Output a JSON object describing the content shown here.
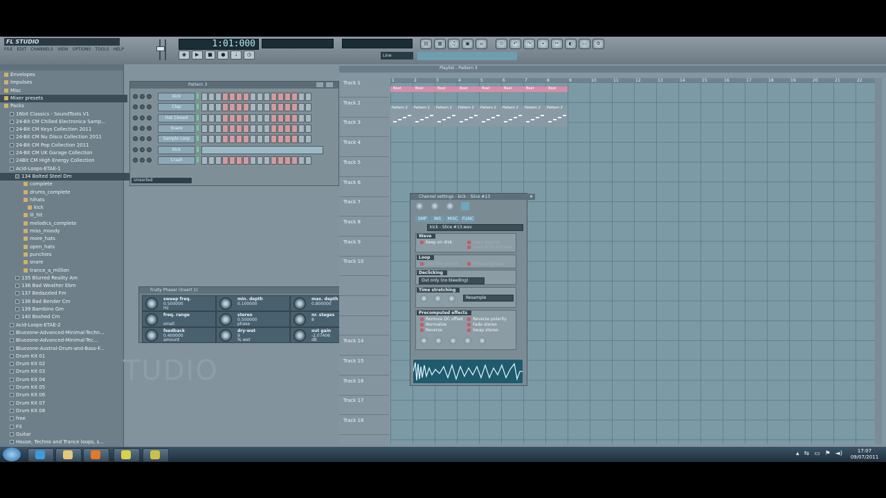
{
  "app": {
    "menu": "FL STUDIO",
    "menu_items": [
      "FILE",
      "EDIT",
      "CHANNELS",
      "VIEW",
      "OPTIONS",
      "TOOLS",
      "HELP"
    ]
  },
  "transport": {
    "time": "1:01:000",
    "line_mode": "Line",
    "hint": ""
  },
  "toolbar_icons": [
    "playlist-icon",
    "stepseq-icon",
    "pianoroll-icon",
    "browser-icon",
    "mixer-icon",
    "plugin-icon",
    "undo-icon",
    "redo-icon",
    "snap-icon",
    "cut-icon",
    "render-icon",
    "save-icon",
    "settings-icon"
  ],
  "browser": {
    "items": [
      {
        "label": "Envelopes",
        "type": "folder",
        "indent": 1
      },
      {
        "label": "Impulses",
        "type": "folder",
        "indent": 1
      },
      {
        "label": "Misc",
        "type": "folder",
        "indent": 1
      },
      {
        "label": "Mixer presets",
        "type": "folder",
        "indent": 1,
        "selected": true
      },
      {
        "label": "Packs",
        "type": "folder",
        "indent": 1
      },
      {
        "label": "16bit Classics - SoundTools V1",
        "type": "pack",
        "indent": 2
      },
      {
        "label": "24-Bit CM Chilled Electronica Samp...",
        "type": "pack",
        "indent": 2
      },
      {
        "label": "24-Bit CM Keys Collection 2011",
        "type": "pack",
        "indent": 2
      },
      {
        "label": "24-Bit CM Nu Disco Collection 2011",
        "type": "pack",
        "indent": 2
      },
      {
        "label": "24-Bit CM Pop Collection 2011",
        "type": "pack",
        "indent": 2
      },
      {
        "label": "24-Bit CM UK Garage Collection",
        "type": "pack",
        "indent": 2
      },
      {
        "label": "24Bit CM High Energy Collection",
        "type": "pack",
        "indent": 2
      },
      {
        "label": "Acid-Loops-ETAE-1",
        "type": "pack",
        "indent": 2
      },
      {
        "label": "134 Bolted Steel Dm",
        "type": "pack",
        "indent": 3,
        "selected": true
      },
      {
        "label": "complete",
        "type": "folder",
        "indent": 4
      },
      {
        "label": "drums_complete",
        "type": "folder",
        "indent": 4
      },
      {
        "label": "hihats",
        "type": "folder",
        "indent": 4
      },
      {
        "label": "kick",
        "type": "folder",
        "indent": 5
      },
      {
        "label": "lil_hit",
        "type": "folder",
        "indent": 4
      },
      {
        "label": "melodics_complete",
        "type": "folder",
        "indent": 4
      },
      {
        "label": "miss_moody",
        "type": "folder",
        "indent": 4
      },
      {
        "label": "more_hats",
        "type": "folder",
        "indent": 4
      },
      {
        "label": "open_hats",
        "type": "folder",
        "indent": 4
      },
      {
        "label": "punchies",
        "type": "folder",
        "indent": 4
      },
      {
        "label": "snare",
        "type": "folder",
        "indent": 4
      },
      {
        "label": "trance_a_million",
        "type": "folder",
        "indent": 4
      },
      {
        "label": "135 Blurred Reality Am",
        "type": "pack",
        "indent": 3
      },
      {
        "label": "136 Bad Weather Ebm",
        "type": "pack",
        "indent": 3
      },
      {
        "label": "137 Bedazzled Fm",
        "type": "pack",
        "indent": 3
      },
      {
        "label": "138 Bad Bender Cm",
        "type": "pack",
        "indent": 3
      },
      {
        "label": "139 Bambino Gm",
        "type": "pack",
        "indent": 3
      },
      {
        "label": "140 Boshed Cm",
        "type": "pack",
        "indent": 3
      },
      {
        "label": "Acid-Loops-ETAE-2",
        "type": "pack",
        "indent": 2
      },
      {
        "label": "Bluezone-Advanced-Minimal-Techn...",
        "type": "pack",
        "indent": 2
      },
      {
        "label": "Bluezone-Advanced-Minimal-Tec...",
        "type": "pack",
        "indent": 2
      },
      {
        "label": "Bluezone-Austral-Drum-and-Bass-F...",
        "type": "pack",
        "indent": 2
      },
      {
        "label": "Drum Kit 01",
        "type": "pack",
        "indent": 2
      },
      {
        "label": "Drum Kit 02",
        "type": "pack",
        "indent": 2
      },
      {
        "label": "Drum Kit 03",
        "type": "pack",
        "indent": 2
      },
      {
        "label": "Drum Kit 04",
        "type": "pack",
        "indent": 2
      },
      {
        "label": "Drum Kit 05",
        "type": "pack",
        "indent": 2
      },
      {
        "label": "Drum Kit 06",
        "type": "pack",
        "indent": 2
      },
      {
        "label": "Drum Kit 07",
        "type": "pack",
        "indent": 2
      },
      {
        "label": "Drum Kit 08",
        "type": "pack",
        "indent": 2
      },
      {
        "label": "free",
        "type": "pack",
        "indent": 2
      },
      {
        "label": "FX",
        "type": "pack",
        "indent": 2
      },
      {
        "label": "Guitar",
        "type": "pack",
        "indent": 2
      },
      {
        "label": "House, Techno and Trance loops, s...",
        "type": "pack",
        "indent": 2
      },
      {
        "label": "Legacy",
        "type": "pack",
        "indent": 2
      }
    ]
  },
  "watermark": "TUDIO",
  "stepseq": {
    "title": "Pattern 3",
    "filter": "Unsorted",
    "channels": [
      {
        "name": "Kick",
        "steps": "gggrrrrgggrrrrgg"
      },
      {
        "name": "Clap",
        "steps": "gggrrrrgggrrrrgg"
      },
      {
        "name": "Hat Closed",
        "steps": "gggrrrrgggrrrrgg"
      },
      {
        "name": "Snare",
        "steps": "gggrrrrgggrrrrgg"
      },
      {
        "name": "Sample Loop",
        "steps": "gggrrrrgggrrrrgg"
      },
      {
        "name": "Kick",
        "steps": "piano"
      },
      {
        "name": "Crash",
        "steps": "gggrrrrgggrrrrgg"
      }
    ]
  },
  "phaser": {
    "title": "Fruity Phaser (Insert 1)",
    "params": [
      {
        "label": "sweep freq.",
        "value": "0.500000",
        "unit": "Hz"
      },
      {
        "label": "min. depth",
        "value": "0.100000",
        "unit": ""
      },
      {
        "label": "max. depth",
        "value": "0.800000",
        "unit": ""
      },
      {
        "label": "freq. range",
        "value": "",
        "unit": "small"
      },
      {
        "label": "stereo",
        "value": "0.500000",
        "unit": "phase"
      },
      {
        "label": "nr. stages",
        "value": "8",
        "unit": ""
      },
      {
        "label": "feedback",
        "value": "0.400000",
        "unit": "amount"
      },
      {
        "label": "dry-wet",
        "value": "9",
        "unit": "% wet"
      },
      {
        "label": "out gain",
        "value": "-2.07406",
        "unit": "dB"
      }
    ]
  },
  "playlist": {
    "title": "Playlist - Pattern 3",
    "ruler": [
      "1",
      "2",
      "3",
      "4",
      "5",
      "6",
      "7",
      "8",
      "9",
      "10",
      "11",
      "12",
      "13",
      "14",
      "15",
      "16",
      "17",
      "18",
      "19",
      "20",
      "21",
      "22"
    ],
    "tracks": [
      "Track 1",
      "Track 2",
      "Track 3",
      "Track 4",
      "Track 5",
      "Track 6",
      "Track 7",
      "Track 8",
      "Track 9",
      "Track 10",
      "",
      "",
      "",
      "Track 14",
      "Track 15",
      "Track 16",
      "Track 17",
      "Track 18"
    ],
    "pattern1_label": "Beat",
    "pattern2_label": "Pattern 2"
  },
  "sampler": {
    "title": "Channel settings - kick - Slice #13",
    "tabs": [
      "SMP",
      "INS",
      "MISC",
      "FUNC"
    ],
    "file": "kick - Slice #13.wav",
    "wave_section": "Wave",
    "wave_opts": [
      "Keep on disk",
      "Load regions",
      "Load ACID markers"
    ],
    "loop_section": "Loop",
    "loop_opts": [
      "Use loop points",
      "Ping-pong loop"
    ],
    "declick_section": "Declicking",
    "declick_value": "Out only (no bleeding)",
    "timestretch_section": "Time stretching",
    "timestretch_mode": "Resample",
    "precomp_section": "Precomputed effects",
    "precomp_opts_left": [
      "Remove DC offset",
      "Normalize",
      "Reverse"
    ],
    "precomp_opts_right": [
      "Reverse polarity",
      "Fade stereo",
      "Swap stereo"
    ]
  },
  "taskbar": {
    "time": "17:07",
    "date": "09/07/2011"
  }
}
